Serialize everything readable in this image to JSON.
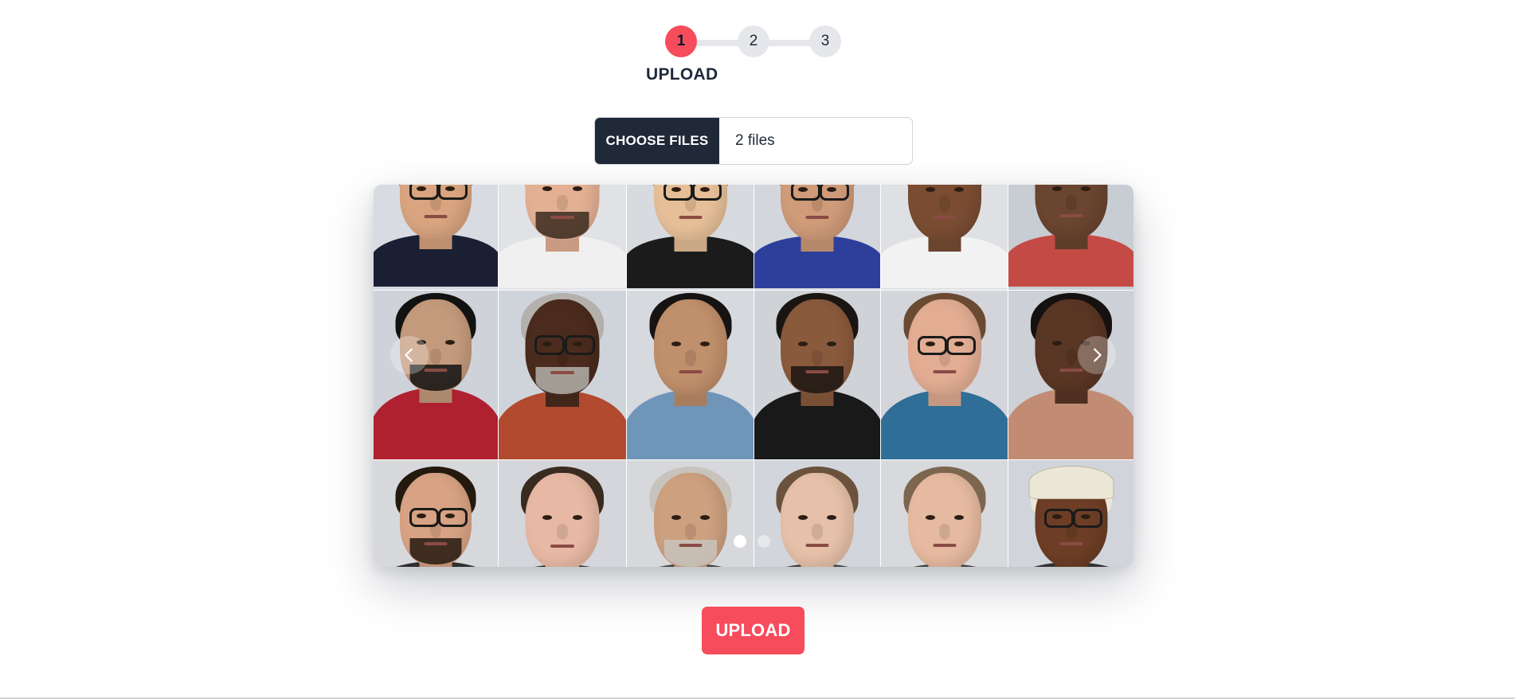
{
  "stepper": {
    "steps": [
      {
        "number": "1",
        "active": true
      },
      {
        "number": "2",
        "active": false
      },
      {
        "number": "3",
        "active": false
      }
    ],
    "current_title": "UPLOAD"
  },
  "file_input": {
    "button_label": "CHOOSE FILES",
    "value": "2 files"
  },
  "carousel": {
    "current_slide": 1,
    "slide_count": 2,
    "prev_icon": "chevron-left-icon",
    "next_icon": "chevron-right-icon",
    "photos": [
      {
        "bg": "#d8dbe2",
        "skin": "#d9a47f",
        "hair": "#2a2119",
        "shirt": "#1a1f33",
        "glasses": true,
        "beard": false
      },
      {
        "bg": "#e1e2e6",
        "skin": "#e3b094",
        "hair": "#3a2a1d",
        "shirt": "#f0f0f0",
        "glasses": false,
        "beard": true
      },
      {
        "bg": "#d7dade",
        "skin": "#e6bf98",
        "hair": "#15110e",
        "shirt": "#1b1b1b",
        "glasses": true,
        "beard": false
      },
      {
        "bg": "#d3d6dc",
        "skin": "#cf9b79",
        "hair": "#1d1512",
        "shirt": "#2d3f9b",
        "glasses": true,
        "beard": false
      },
      {
        "bg": "#dfe0e3",
        "skin": "#7a4d33",
        "hair": "#120d0a",
        "shirt": "#f2f2f2",
        "glasses": false,
        "beard": false
      },
      {
        "bg": "#c8ccd3",
        "skin": "#6a452f",
        "hair": "#14100d",
        "shirt": "#c44a45",
        "glasses": false,
        "beard": false
      },
      {
        "bg": "#cfd2d9",
        "skin": "#c49a7c",
        "hair": "#121212",
        "shirt": "#b0212f",
        "glasses": false,
        "beard": true
      },
      {
        "bg": "#cfd4db",
        "skin": "#4b2b1d",
        "hair": "#b4b1ac",
        "shirt": "#b14a2e",
        "glasses": true,
        "beard": true
      },
      {
        "bg": "#d6d9de",
        "skin": "#c08f6b",
        "hair": "#161312",
        "shirt": "#6f95b9",
        "glasses": false,
        "beard": false
      },
      {
        "bg": "#cfd3d8",
        "skin": "#8a5a3d",
        "hair": "#1b1512",
        "shirt": "#191919",
        "glasses": false,
        "beard": true
      },
      {
        "bg": "#d3d5da",
        "skin": "#e2ad93",
        "hair": "#6b4a33",
        "shirt": "#2e6e97",
        "glasses": true,
        "beard": false
      },
      {
        "bg": "#cdd0d6",
        "skin": "#5a3624",
        "hair": "#151111",
        "shirt": "#c28c74",
        "glasses": false,
        "beard": false
      },
      {
        "bg": "#d6d8dc",
        "skin": "#d8a384",
        "hair": "#24190f",
        "shirt": "#2f2f2f",
        "glasses": true,
        "beard": true
      },
      {
        "bg": "#d4d6db",
        "skin": "#e7b9a4",
        "hair": "#3a2b20",
        "shirt": "#2f2f2f",
        "glasses": false,
        "beard": false
      },
      {
        "bg": "#d7d8dc",
        "skin": "#cda07f",
        "hair": "#c8c3bc",
        "shirt": "#444444",
        "glasses": false,
        "beard": true
      },
      {
        "bg": "#d2d5db",
        "skin": "#e6c0a8",
        "hair": "#6a523d",
        "shirt": "#444444",
        "glasses": false,
        "beard": false
      },
      {
        "bg": "#d7d9dd",
        "skin": "#e6baa0",
        "hair": "#7d6650",
        "shirt": "#444444",
        "glasses": false,
        "beard": false
      },
      {
        "bg": "#d1d5db",
        "skin": "#6d3e25",
        "hair": "#ece6d7",
        "shirt": "#333333",
        "glasses": true,
        "beard": false,
        "cap": true
      }
    ]
  },
  "actions": {
    "upload_label": "UPLOAD"
  },
  "colors": {
    "accent": "#f64c5c",
    "dark": "#1f2937",
    "step_inactive": "#e5e7eb"
  }
}
